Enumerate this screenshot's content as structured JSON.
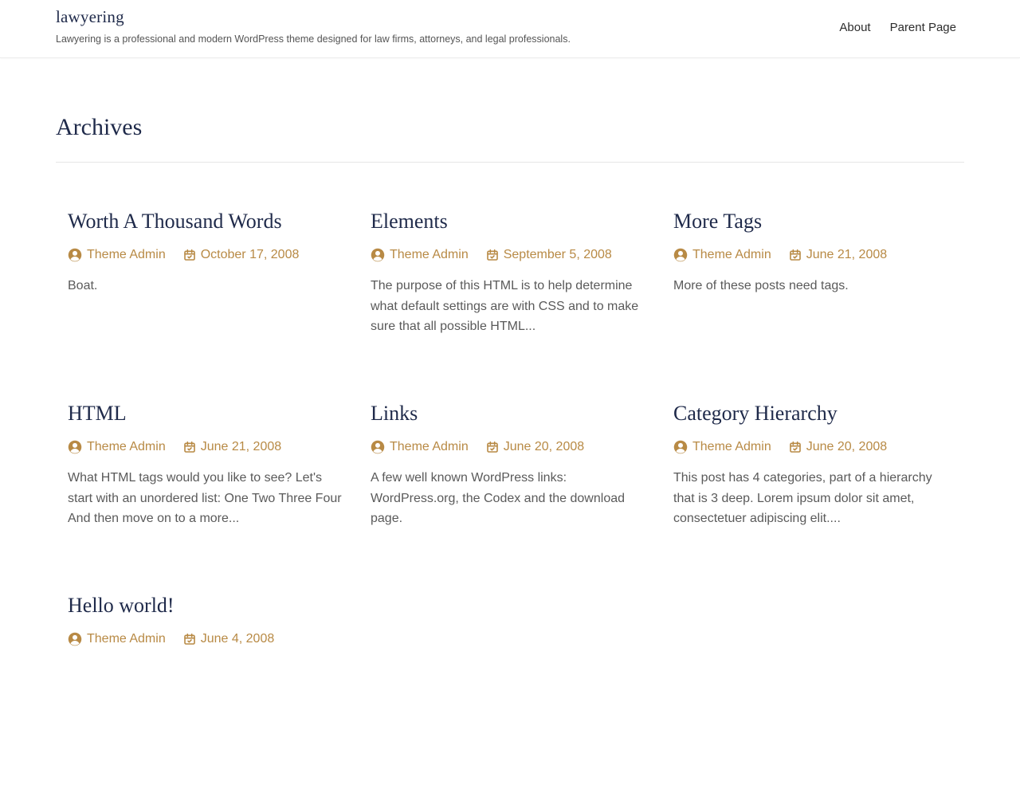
{
  "site": {
    "title": "lawyering",
    "description": "Lawyering is a professional and modern WordPress theme designed for law firms, attorneys, and legal professionals."
  },
  "nav": {
    "items": [
      {
        "label": "About"
      },
      {
        "label": "Parent Page"
      }
    ]
  },
  "archive": {
    "title": "Archives"
  },
  "colors": {
    "accent": "#b88a45",
    "heading": "#1f2a4a",
    "text": "#5a5a5a"
  },
  "icons": {
    "author": "user-circle-icon",
    "date": "calendar-icon"
  },
  "posts": [
    {
      "title": "Worth A Thousand Words",
      "author": "Theme Admin",
      "date": "October 17, 2008",
      "excerpt": "Boat."
    },
    {
      "title": "Elements",
      "author": "Theme Admin",
      "date": "September 5, 2008",
      "excerpt": "The purpose of this HTML is to help determine what default settings are with CSS and to make sure that all possible HTML..."
    },
    {
      "title": "More Tags",
      "author": "Theme Admin",
      "date": "June 21, 2008",
      "excerpt": "More of these posts need tags."
    },
    {
      "title": "HTML",
      "author": "Theme Admin",
      "date": "June 21, 2008",
      "excerpt": "What HTML tags would you like to see? Let's start with an unordered list: One Two Three Four And then move on to a more..."
    },
    {
      "title": "Links",
      "author": "Theme Admin",
      "date": "June 20, 2008",
      "excerpt": "A few well known WordPress links: WordPress.org, the Codex and the download page."
    },
    {
      "title": "Category Hierarchy",
      "author": "Theme Admin",
      "date": "June 20, 2008",
      "excerpt": "This post has 4 categories, part of a hierarchy that is 3 deep. Lorem ipsum dolor sit amet, consectetuer adipiscing elit...."
    },
    {
      "title": "Hello world!",
      "author": "Theme Admin",
      "date": "June 4, 2008",
      "excerpt": ""
    }
  ]
}
